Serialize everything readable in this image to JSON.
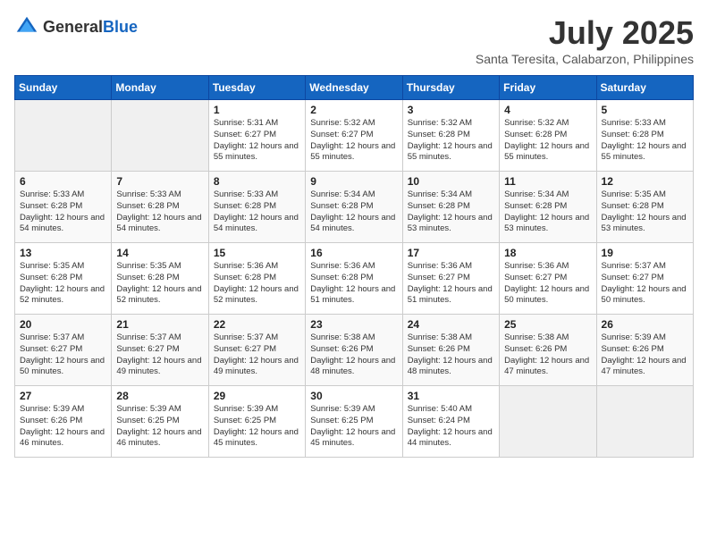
{
  "header": {
    "logo_general": "General",
    "logo_blue": "Blue",
    "month_year": "July 2025",
    "location": "Santa Teresita, Calabarzon, Philippines"
  },
  "days_of_week": [
    "Sunday",
    "Monday",
    "Tuesday",
    "Wednesday",
    "Thursday",
    "Friday",
    "Saturday"
  ],
  "weeks": [
    [
      {
        "day": "",
        "info": ""
      },
      {
        "day": "",
        "info": ""
      },
      {
        "day": "1",
        "sunrise": "Sunrise: 5:31 AM",
        "sunset": "Sunset: 6:27 PM",
        "daylight": "Daylight: 12 hours and 55 minutes."
      },
      {
        "day": "2",
        "sunrise": "Sunrise: 5:32 AM",
        "sunset": "Sunset: 6:27 PM",
        "daylight": "Daylight: 12 hours and 55 minutes."
      },
      {
        "day": "3",
        "sunrise": "Sunrise: 5:32 AM",
        "sunset": "Sunset: 6:28 PM",
        "daylight": "Daylight: 12 hours and 55 minutes."
      },
      {
        "day": "4",
        "sunrise": "Sunrise: 5:32 AM",
        "sunset": "Sunset: 6:28 PM",
        "daylight": "Daylight: 12 hours and 55 minutes."
      },
      {
        "day": "5",
        "sunrise": "Sunrise: 5:33 AM",
        "sunset": "Sunset: 6:28 PM",
        "daylight": "Daylight: 12 hours and 55 minutes."
      }
    ],
    [
      {
        "day": "6",
        "sunrise": "Sunrise: 5:33 AM",
        "sunset": "Sunset: 6:28 PM",
        "daylight": "Daylight: 12 hours and 54 minutes."
      },
      {
        "day": "7",
        "sunrise": "Sunrise: 5:33 AM",
        "sunset": "Sunset: 6:28 PM",
        "daylight": "Daylight: 12 hours and 54 minutes."
      },
      {
        "day": "8",
        "sunrise": "Sunrise: 5:33 AM",
        "sunset": "Sunset: 6:28 PM",
        "daylight": "Daylight: 12 hours and 54 minutes."
      },
      {
        "day": "9",
        "sunrise": "Sunrise: 5:34 AM",
        "sunset": "Sunset: 6:28 PM",
        "daylight": "Daylight: 12 hours and 54 minutes."
      },
      {
        "day": "10",
        "sunrise": "Sunrise: 5:34 AM",
        "sunset": "Sunset: 6:28 PM",
        "daylight": "Daylight: 12 hours and 53 minutes."
      },
      {
        "day": "11",
        "sunrise": "Sunrise: 5:34 AM",
        "sunset": "Sunset: 6:28 PM",
        "daylight": "Daylight: 12 hours and 53 minutes."
      },
      {
        "day": "12",
        "sunrise": "Sunrise: 5:35 AM",
        "sunset": "Sunset: 6:28 PM",
        "daylight": "Daylight: 12 hours and 53 minutes."
      }
    ],
    [
      {
        "day": "13",
        "sunrise": "Sunrise: 5:35 AM",
        "sunset": "Sunset: 6:28 PM",
        "daylight": "Daylight: 12 hours and 52 minutes."
      },
      {
        "day": "14",
        "sunrise": "Sunrise: 5:35 AM",
        "sunset": "Sunset: 6:28 PM",
        "daylight": "Daylight: 12 hours and 52 minutes."
      },
      {
        "day": "15",
        "sunrise": "Sunrise: 5:36 AM",
        "sunset": "Sunset: 6:28 PM",
        "daylight": "Daylight: 12 hours and 52 minutes."
      },
      {
        "day": "16",
        "sunrise": "Sunrise: 5:36 AM",
        "sunset": "Sunset: 6:28 PM",
        "daylight": "Daylight: 12 hours and 51 minutes."
      },
      {
        "day": "17",
        "sunrise": "Sunrise: 5:36 AM",
        "sunset": "Sunset: 6:27 PM",
        "daylight": "Daylight: 12 hours and 51 minutes."
      },
      {
        "day": "18",
        "sunrise": "Sunrise: 5:36 AM",
        "sunset": "Sunset: 6:27 PM",
        "daylight": "Daylight: 12 hours and 50 minutes."
      },
      {
        "day": "19",
        "sunrise": "Sunrise: 5:37 AM",
        "sunset": "Sunset: 6:27 PM",
        "daylight": "Daylight: 12 hours and 50 minutes."
      }
    ],
    [
      {
        "day": "20",
        "sunrise": "Sunrise: 5:37 AM",
        "sunset": "Sunset: 6:27 PM",
        "daylight": "Daylight: 12 hours and 50 minutes."
      },
      {
        "day": "21",
        "sunrise": "Sunrise: 5:37 AM",
        "sunset": "Sunset: 6:27 PM",
        "daylight": "Daylight: 12 hours and 49 minutes."
      },
      {
        "day": "22",
        "sunrise": "Sunrise: 5:37 AM",
        "sunset": "Sunset: 6:27 PM",
        "daylight": "Daylight: 12 hours and 49 minutes."
      },
      {
        "day": "23",
        "sunrise": "Sunrise: 5:38 AM",
        "sunset": "Sunset: 6:26 PM",
        "daylight": "Daylight: 12 hours and 48 minutes."
      },
      {
        "day": "24",
        "sunrise": "Sunrise: 5:38 AM",
        "sunset": "Sunset: 6:26 PM",
        "daylight": "Daylight: 12 hours and 48 minutes."
      },
      {
        "day": "25",
        "sunrise": "Sunrise: 5:38 AM",
        "sunset": "Sunset: 6:26 PM",
        "daylight": "Daylight: 12 hours and 47 minutes."
      },
      {
        "day": "26",
        "sunrise": "Sunrise: 5:39 AM",
        "sunset": "Sunset: 6:26 PM",
        "daylight": "Daylight: 12 hours and 47 minutes."
      }
    ],
    [
      {
        "day": "27",
        "sunrise": "Sunrise: 5:39 AM",
        "sunset": "Sunset: 6:26 PM",
        "daylight": "Daylight: 12 hours and 46 minutes."
      },
      {
        "day": "28",
        "sunrise": "Sunrise: 5:39 AM",
        "sunset": "Sunset: 6:25 PM",
        "daylight": "Daylight: 12 hours and 46 minutes."
      },
      {
        "day": "29",
        "sunrise": "Sunrise: 5:39 AM",
        "sunset": "Sunset: 6:25 PM",
        "daylight": "Daylight: 12 hours and 45 minutes."
      },
      {
        "day": "30",
        "sunrise": "Sunrise: 5:39 AM",
        "sunset": "Sunset: 6:25 PM",
        "daylight": "Daylight: 12 hours and 45 minutes."
      },
      {
        "day": "31",
        "sunrise": "Sunrise: 5:40 AM",
        "sunset": "Sunset: 6:24 PM",
        "daylight": "Daylight: 12 hours and 44 minutes."
      },
      {
        "day": "",
        "info": ""
      },
      {
        "day": "",
        "info": ""
      }
    ]
  ]
}
